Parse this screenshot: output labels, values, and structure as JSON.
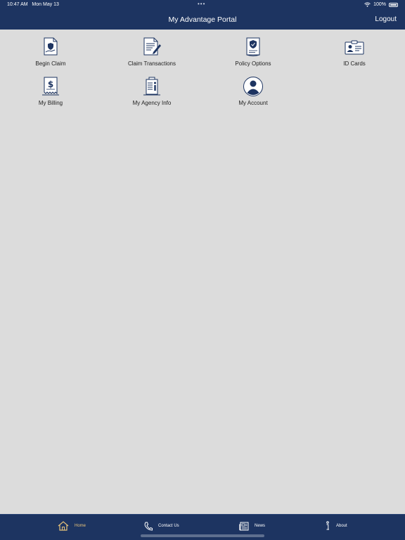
{
  "status_bar": {
    "time": "10:47 AM",
    "date": "Mon May 13",
    "dots": "•••",
    "battery": "100%"
  },
  "header": {
    "title": "My Advantage Portal",
    "logout_label": "Logout"
  },
  "tiles": [
    {
      "label": "Begin Claim",
      "icon": "begin-claim-icon"
    },
    {
      "label": "Claim Transactions",
      "icon": "claim-transactions-icon"
    },
    {
      "label": "Policy Options",
      "icon": "policy-options-icon"
    },
    {
      "label": "ID Cards",
      "icon": "id-card-icon"
    },
    {
      "label": "My Billing",
      "icon": "billing-icon"
    },
    {
      "label": "My Agency Info",
      "icon": "agency-info-icon"
    },
    {
      "label": "My Account",
      "icon": "account-icon"
    }
  ],
  "tab_bar": {
    "items": [
      {
        "label": "Home",
        "icon": "home-icon",
        "active": true
      },
      {
        "label": "Contact Us",
        "icon": "phone-icon",
        "active": false
      },
      {
        "label": "News",
        "icon": "news-icon",
        "active": false
      },
      {
        "label": "About",
        "icon": "info-icon",
        "active": false
      }
    ]
  },
  "colors": {
    "header_bg": "#1d3461",
    "page_bg": "#dcdcdc",
    "icon_navy": "#1d3461",
    "active_tab": "#e6c27a"
  }
}
